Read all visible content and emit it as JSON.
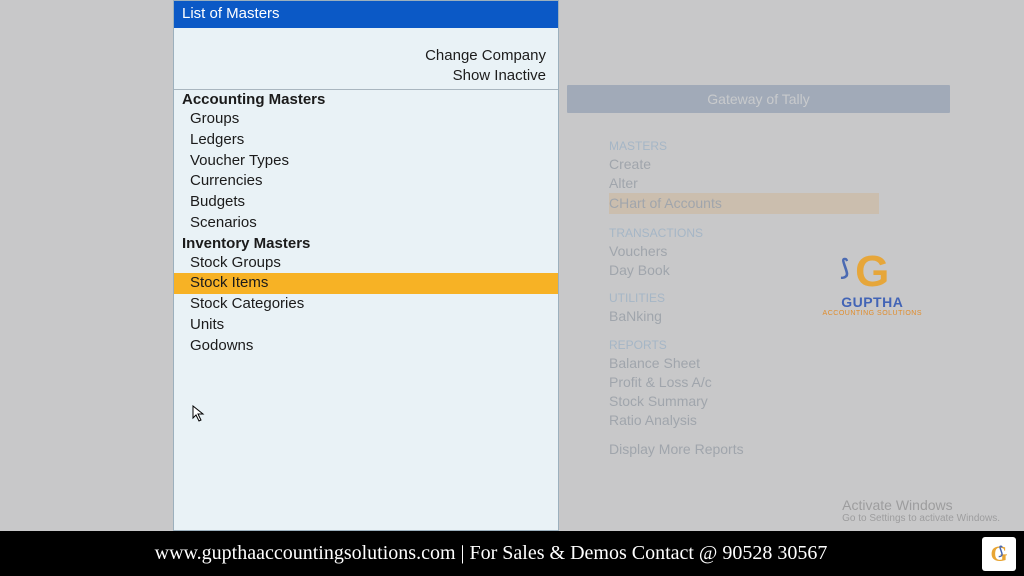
{
  "panel": {
    "title": "List of Masters",
    "actions": {
      "change": "Change Company",
      "inactive": "Show Inactive"
    },
    "section1": "Accounting Masters",
    "acc": {
      "groups": "Groups",
      "ledgers": "Ledgers",
      "vtypes": "Voucher Types",
      "currencies": "Currencies",
      "budgets": "Budgets",
      "scenarios": "Scenarios"
    },
    "section2": "Inventory Masters",
    "inv": {
      "sgroups": "Stock Groups",
      "sitems": "Stock Items",
      "scats": "Stock Categories",
      "units": "Units",
      "godowns": "Godowns"
    }
  },
  "gateway": {
    "title": "Gateway of Tally",
    "cat_masters": "MASTERS",
    "create": "Create",
    "alter": "Alter",
    "chart": "CHart of Accounts",
    "cat_trans": "TRANSACTIONS",
    "vouchers": "Vouchers",
    "daybook": "Day Book",
    "cat_util": "UTILITIES",
    "banking": "BaNking",
    "cat_rep": "REPORTS",
    "bs": "Balance Sheet",
    "pl": "Profit & Loss A/c",
    "ss": "Stock Summary",
    "ra": "Ratio Analysis",
    "more": "Display More Reports"
  },
  "logo": {
    "brand": "GUPTHA",
    "sub": "ACCOUNTING SOLUTIONS"
  },
  "activate": {
    "t1": "Activate Windows",
    "t2": "Go to Settings to activate Windows."
  },
  "footer": "www.gupthaaccountingsolutions.com | For Sales & Demos Contact @ 90528 30567"
}
